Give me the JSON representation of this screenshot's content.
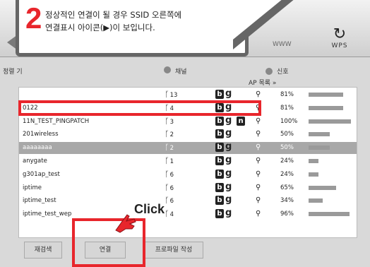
{
  "callout": {
    "step": "2",
    "line1": "정상적인 연결이 될 경우 SSID 오른쪽에",
    "line2": "연결표시 아이콘(▶)이 보입니다."
  },
  "toolbar": {
    "wps_label": "WPS",
    "www_label": "WWW"
  },
  "list_header": {
    "left_label": "정렬 기",
    "channel_label": "채널",
    "signal_label": "신호",
    "ap_list_label": "AP 목록 »"
  },
  "networks": [
    {
      "ssid": "",
      "channel": "13",
      "b": "b",
      "g": "g",
      "n": "",
      "pct": "81%",
      "strength": 0.81,
      "selected": false
    },
    {
      "ssid": "0122",
      "channel": "4",
      "b": "b",
      "g": "g",
      "n": "",
      "pct": "81%",
      "strength": 0.81,
      "selected": false
    },
    {
      "ssid": "11N_TEST_PINGPATCH",
      "channel": "3",
      "b": "b",
      "g": "g",
      "n": "n",
      "pct": "100%",
      "strength": 1.0,
      "selected": false
    },
    {
      "ssid": "201wireless",
      "channel": "2",
      "b": "b",
      "g": "g",
      "n": "",
      "pct": "50%",
      "strength": 0.5,
      "selected": false
    },
    {
      "ssid": "aaaaaaaa",
      "channel": "2",
      "b": "b",
      "g": "g",
      "n": "",
      "pct": "50%",
      "strength": 0.5,
      "selected": true
    },
    {
      "ssid": "anygate",
      "channel": "1",
      "b": "b",
      "g": "g",
      "n": "",
      "pct": "24%",
      "strength": 0.24,
      "selected": false
    },
    {
      "ssid": "g301ap_test",
      "channel": "6",
      "b": "b",
      "g": "g",
      "n": "",
      "pct": "24%",
      "strength": 0.24,
      "selected": false
    },
    {
      "ssid": "iptime",
      "channel": "6",
      "b": "b",
      "g": "g",
      "n": "",
      "pct": "65%",
      "strength": 0.65,
      "selected": false
    },
    {
      "ssid": "iptime_test",
      "channel": "6",
      "b": "b",
      "g": "g",
      "n": "",
      "pct": "34%",
      "strength": 0.34,
      "selected": false
    },
    {
      "ssid": "iptime_test_wep",
      "channel": "4",
      "b": "b",
      "g": "g",
      "n": "",
      "pct": "96%",
      "strength": 0.96,
      "selected": false
    }
  ],
  "annotation": {
    "click_label": "Click"
  },
  "buttons": {
    "rescan": "재검색",
    "connect": "연결",
    "profile": "프로파일 작성"
  },
  "colors": {
    "highlight": "#e8262c"
  }
}
